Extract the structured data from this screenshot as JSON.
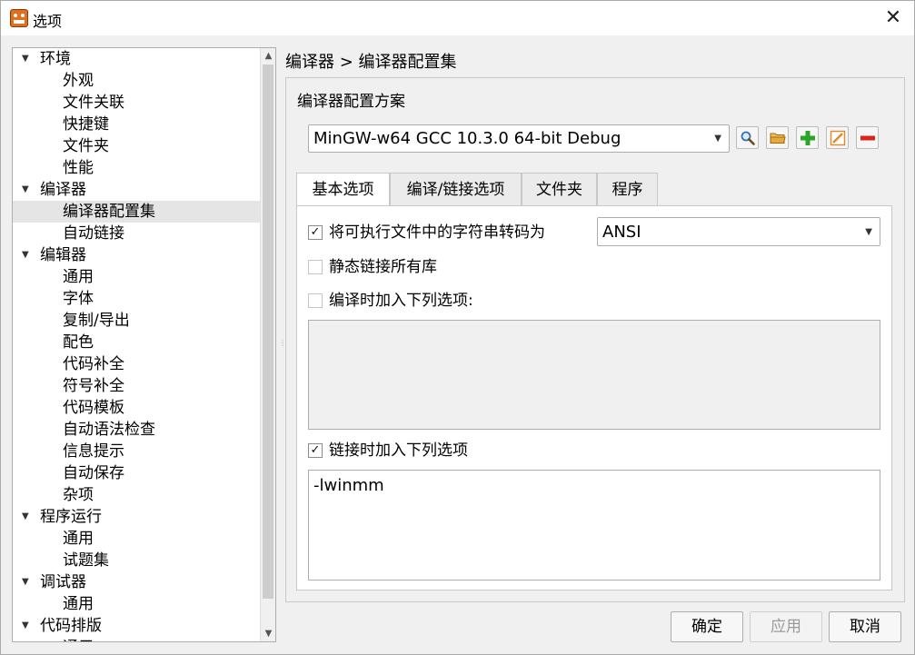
{
  "window": {
    "title": "选项",
    "close_glyph": "✕"
  },
  "tree": {
    "items": [
      {
        "label": "环境",
        "level": 0,
        "expanded": true
      },
      {
        "label": "外观",
        "level": 1
      },
      {
        "label": "文件关联",
        "level": 1
      },
      {
        "label": "快捷键",
        "level": 1
      },
      {
        "label": "文件夹",
        "level": 1
      },
      {
        "label": "性能",
        "level": 1
      },
      {
        "label": "编译器",
        "level": 0,
        "expanded": true
      },
      {
        "label": "编译器配置集",
        "level": 1,
        "selected": true
      },
      {
        "label": "自动链接",
        "level": 1
      },
      {
        "label": "编辑器",
        "level": 0,
        "expanded": true
      },
      {
        "label": "通用",
        "level": 1
      },
      {
        "label": "字体",
        "level": 1
      },
      {
        "label": "复制/导出",
        "level": 1
      },
      {
        "label": "配色",
        "level": 1
      },
      {
        "label": "代码补全",
        "level": 1
      },
      {
        "label": "符号补全",
        "level": 1
      },
      {
        "label": "代码模板",
        "level": 1
      },
      {
        "label": "自动语法检查",
        "level": 1
      },
      {
        "label": "信息提示",
        "level": 1
      },
      {
        "label": "自动保存",
        "level": 1
      },
      {
        "label": "杂项",
        "level": 1
      },
      {
        "label": "程序运行",
        "level": 0,
        "expanded": true
      },
      {
        "label": "通用",
        "level": 1
      },
      {
        "label": "试题集",
        "level": 1
      },
      {
        "label": "调试器",
        "level": 0,
        "expanded": true
      },
      {
        "label": "通用",
        "level": 1
      },
      {
        "label": "代码排版",
        "level": 0,
        "expanded": true
      },
      {
        "label": "通用",
        "level": 1
      }
    ]
  },
  "breadcrumb": "编译器 > 编译器配置集",
  "group": {
    "title": "编译器配置方案",
    "selected_profile": "MinGW-w64 GCC 10.3.0 64-bit Debug",
    "tool_icons": [
      "search-icon",
      "folder-icon",
      "add-icon",
      "edit-icon",
      "remove-icon"
    ]
  },
  "tabs": [
    {
      "label": "基本选项",
      "active": true
    },
    {
      "label": "编译/链接选项"
    },
    {
      "label": "文件夹"
    },
    {
      "label": "程序"
    }
  ],
  "basic": {
    "convert_label": "将可执行文件中的字符串转码为",
    "convert_checked": true,
    "encoding": "ANSI",
    "static_label": "静态链接所有库",
    "static_checked": false,
    "compile_label": "编译时加入下列选项:",
    "compile_checked": false,
    "compile_value": "",
    "link_label": "链接时加入下列选项",
    "link_checked": true,
    "link_value": "-lwinmm"
  },
  "buttons": {
    "ok": "确定",
    "apply": "应用",
    "cancel": "取消"
  },
  "colors": {
    "accent_green": "#2aa52a",
    "remove_red": "#d9241c"
  }
}
